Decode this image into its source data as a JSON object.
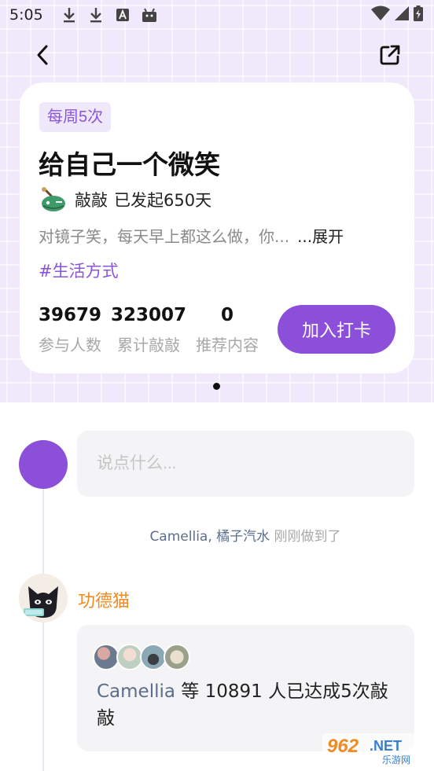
{
  "status_bar": {
    "time": "5:05"
  },
  "card": {
    "frequency_badge": "每周5次",
    "title": "给自己一个微笑",
    "starter_name": "敲敲",
    "started_days": "已发起650天",
    "description": "对镜子笑，每天早上都这么做，你...",
    "expand_label": "...展开",
    "tag": "#生活方式",
    "stats": [
      {
        "value": "39679",
        "label": "参与人数"
      },
      {
        "value": "323007",
        "label": "累计敲敲"
      },
      {
        "value": "0",
        "label": "推荐内容"
      }
    ],
    "join_button": "加入打卡"
  },
  "comment": {
    "placeholder": "说点什么..."
  },
  "just_done": {
    "names": "Camellia, 橘子汽水",
    "suffix": " 刚刚做到了"
  },
  "post": {
    "author": "功德猫",
    "achievement_name": "Camellia",
    "achievement_text": " 等 10891 人已达成5次敲敲"
  },
  "watermark": {
    "number": "962",
    "suffix": ".NET",
    "caption": "乐游网"
  },
  "colors": {
    "accent": "#8b4fd9",
    "author": "#f08a22",
    "link": "#5a6d8c"
  }
}
